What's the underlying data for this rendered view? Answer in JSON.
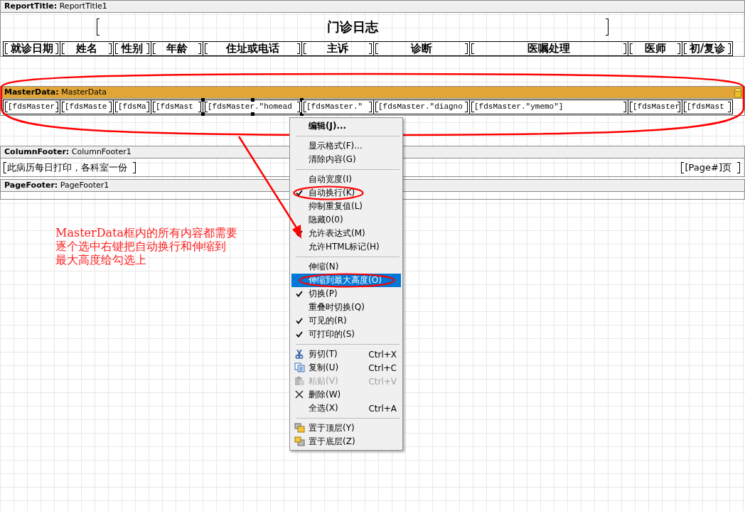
{
  "bands": [
    {
      "kind": "title",
      "label": "**ReportTitle:** ReportTitle1",
      "circled": false,
      "title": "门诊日志",
      "cells": [
        {
          "text": "就诊日期",
          "selected": false
        },
        {
          "text": "姓名",
          "selected": false
        },
        {
          "text": "性别",
          "selected": false
        },
        {
          "text": "年龄",
          "selected": false
        },
        {
          "text": "住址或电话",
          "selected": false
        },
        {
          "text": "主诉",
          "selected": false
        },
        {
          "text": "诊断",
          "selected": false
        },
        {
          "text": "医嘱处理",
          "selected": false
        },
        {
          "text": "医师",
          "selected": false
        },
        {
          "text": "初/复诊",
          "selected": false
        }
      ]
    },
    {
      "kind": "data",
      "label": "**MasterData:** MasterData",
      "circled": true,
      "cells": [
        {
          "text": "[fdsMaster.",
          "selected": false
        },
        {
          "text": "[fdsMaste",
          "selected": false
        },
        {
          "text": "[fdsMa",
          "selected": false
        },
        {
          "text": "[fdsMast",
          "selected": false
        },
        {
          "text": "[fdsMaster.″homead",
          "selected": true
        },
        {
          "text": "[fdsMaster.″",
          "selected": false
        },
        {
          "text": "[fdsMaster.″diagno",
          "selected": false
        },
        {
          "text": "[fdsMaster.″ymemo″]",
          "selected": false
        },
        {
          "text": "[fdsMaster",
          "selected": false
        },
        {
          "text": "[fdsMast",
          "selected": false
        }
      ]
    },
    {
      "kind": "column-footer",
      "label": "**ColumnFooter:** ColumnFooter1",
      "circled": false,
      "cells": [
        {
          "text": "此病历每日打印，各科室一份",
          "selected": false
        },
        {
          "text": "[Page#]页",
          "selected": false
        }
      ]
    },
    {
      "kind": "page-footer",
      "label": "**PageFooter:** PageFooter1",
      "circled": false
    }
  ],
  "context_menu": {
    "items": [
      {
        "kind": "plain",
        "label": "编辑(J)...",
        "default": true,
        "checked": false,
        "selected": false,
        "disabled": false,
        "circled": false
      },
      {
        "kind": "separator"
      },
      {
        "kind": "plain",
        "label": "显示格式(F)...",
        "default": false,
        "checked": false,
        "selected": false,
        "disabled": false,
        "circled": false
      },
      {
        "kind": "plain",
        "label": "清除内容(G)",
        "default": false,
        "checked": false,
        "selected": false,
        "disabled": false,
        "circled": false
      },
      {
        "kind": "separator"
      },
      {
        "kind": "plain",
        "label": "自动宽度(I)",
        "default": false,
        "checked": false,
        "selected": false,
        "disabled": false,
        "circled": false
      },
      {
        "kind": "plain",
        "label": "自动换行(K)",
        "default": false,
        "checked": true,
        "selected": false,
        "disabled": false,
        "circled": true
      },
      {
        "kind": "plain",
        "label": "抑制重复值(L)",
        "default": false,
        "checked": false,
        "selected": false,
        "disabled": false,
        "circled": false
      },
      {
        "kind": "plain",
        "label": "隐藏0(0)",
        "default": false,
        "checked": false,
        "selected": false,
        "disabled": false,
        "circled": false
      },
      {
        "kind": "plain",
        "label": "允许表达式(M)",
        "default": false,
        "checked": true,
        "selected": false,
        "disabled": false,
        "circled": false
      },
      {
        "kind": "plain",
        "label": "允许HTML标记(H)",
        "default": false,
        "checked": false,
        "selected": false,
        "disabled": false,
        "circled": false
      },
      {
        "kind": "separator"
      },
      {
        "kind": "plain",
        "label": "伸缩(N)",
        "default": false,
        "checked": false,
        "selected": false,
        "disabled": false,
        "circled": false
      },
      {
        "kind": "plain",
        "label": "伸缩到最大高度(O)",
        "default": false,
        "checked": false,
        "selected": true,
        "disabled": false,
        "circled": true
      },
      {
        "kind": "plain",
        "label": "切换(P)",
        "default": false,
        "checked": true,
        "selected": false,
        "disabled": false,
        "circled": false
      },
      {
        "kind": "plain",
        "label": "重叠时切换(Q)",
        "default": false,
        "checked": false,
        "selected": false,
        "disabled": false,
        "circled": false
      },
      {
        "kind": "plain",
        "label": "可见的(R)",
        "default": false,
        "checked": true,
        "selected": false,
        "disabled": false,
        "circled": false
      },
      {
        "kind": "plain",
        "label": "可打印的(S)",
        "default": false,
        "checked": true,
        "selected": false,
        "disabled": false,
        "circled": false
      },
      {
        "kind": "separator"
      },
      {
        "kind": "cut",
        "label": "剪切(T)",
        "shortcut": "Ctrl+X",
        "default": false,
        "checked": false,
        "selected": false,
        "disabled": false,
        "circled": false
      },
      {
        "kind": "copy",
        "label": "复制(U)",
        "shortcut": "Ctrl+C",
        "default": false,
        "checked": false,
        "selected": false,
        "disabled": false,
        "circled": false
      },
      {
        "kind": "paste",
        "label": "粘贴(V)",
        "shortcut": "Ctrl+V",
        "default": false,
        "checked": false,
        "selected": false,
        "disabled": true,
        "circled": false
      },
      {
        "kind": "delete",
        "label": "删除(W)",
        "default": false,
        "checked": false,
        "selected": false,
        "disabled": false,
        "circled": false
      },
      {
        "kind": "plain",
        "label": "全选(X)",
        "shortcut": "Ctrl+A",
        "default": false,
        "checked": false,
        "selected": false,
        "disabled": false,
        "circled": false
      },
      {
        "kind": "separator"
      },
      {
        "kind": "bring-front",
        "label": "置于顶层(Y)",
        "default": false,
        "checked": false,
        "selected": false,
        "disabled": false,
        "circled": false
      },
      {
        "kind": "send-back",
        "label": "置于底层(Z)",
        "default": false,
        "checked": false,
        "selected": false,
        "disabled": false,
        "circled": false
      }
    ]
  },
  "annotation": {
    "lines": [
      "MasterData框内的所有内容都需要",
      "逐个选中右键把自动换行和伸缩到",
      "最大高度给勾选上"
    ]
  }
}
